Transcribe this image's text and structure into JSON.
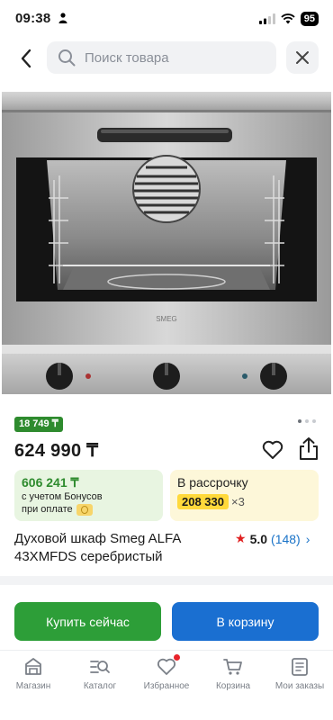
{
  "status": {
    "time": "09:38",
    "battery": "95"
  },
  "search": {
    "placeholder": "Поиск товара"
  },
  "product": {
    "bonus_badge": "18 749 ₸",
    "price": "624 990 ₸",
    "bonus_card": {
      "amount": "606 241 ₸",
      "line1": "с учетом Бонусов",
      "line2": "при оплате"
    },
    "installment_card": {
      "title": "В рассрочку",
      "monthly": "208 330",
      "multiplier": "×3"
    },
    "title": "Духовой шкаф Smeg ALFA 43XMFDS серебристый",
    "rating": {
      "score": "5.0",
      "count": "(148)"
    },
    "brand_mark": "SMEG"
  },
  "actions": {
    "buy_now": "Купить сейчас",
    "add_to_cart": "В корзину"
  },
  "tabs": [
    {
      "label": "Магазин",
      "icon": "store-icon"
    },
    {
      "label": "Каталог",
      "icon": "catalog-icon"
    },
    {
      "label": "Избранное",
      "icon": "heart-icon",
      "has_badge": true
    },
    {
      "label": "Корзина",
      "icon": "cart-icon"
    },
    {
      "label": "Мои заказы",
      "icon": "orders-icon"
    }
  ],
  "colors": {
    "green": "#2e8b2e",
    "blue": "#1a6fd1",
    "buy_green": "#2d9e38",
    "rating_star": "#e02020",
    "link": "#1a73c8"
  }
}
